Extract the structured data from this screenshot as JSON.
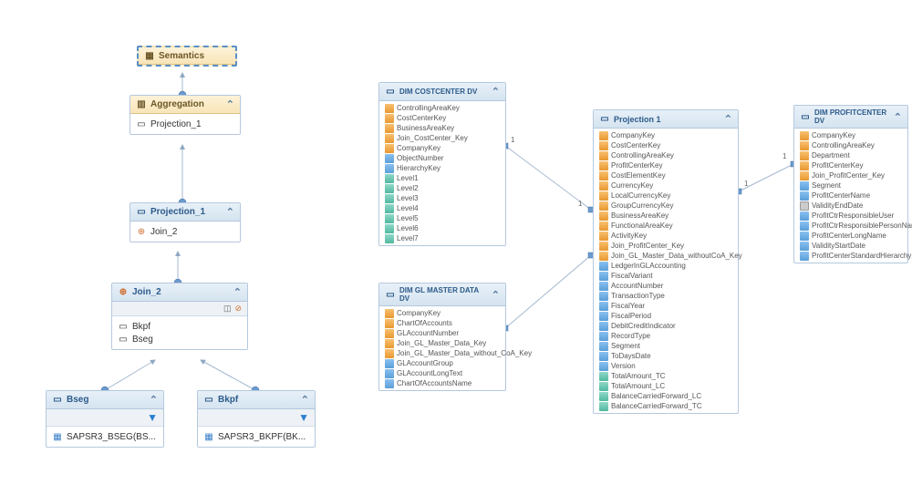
{
  "tree": {
    "semantics": {
      "title": "Semantics"
    },
    "aggregation": {
      "title": "Aggregation",
      "children": [
        "Projection_1"
      ]
    },
    "projection1": {
      "title": "Projection_1",
      "children": [
        "Join_2"
      ]
    },
    "join2": {
      "title": "Join_2",
      "children": [
        "Bkpf",
        "Bseg"
      ]
    },
    "bseg": {
      "title": "Bseg",
      "children": [
        "SAPSR3_BSEG(BS..."
      ]
    },
    "bkpf": {
      "title": "Bkpf",
      "children": [
        "SAPSR3_BKPF(BK..."
      ]
    }
  },
  "entities": {
    "costcenter": {
      "title": "DIM COSTCENTER DV",
      "fields": [
        {
          "icon": "orange",
          "name": "ControllingAreaKey"
        },
        {
          "icon": "orange",
          "name": "CostCenterKey"
        },
        {
          "icon": "orange",
          "name": "BusinessAreaKey"
        },
        {
          "icon": "orange",
          "name": "Join_CostCenter_Key"
        },
        {
          "icon": "orange",
          "name": "CompanyKey"
        },
        {
          "icon": "blue",
          "name": "ObjectNumber"
        },
        {
          "icon": "blue",
          "name": "HierarchyKey"
        },
        {
          "icon": "teal",
          "name": "Level1"
        },
        {
          "icon": "teal",
          "name": "Level2"
        },
        {
          "icon": "teal",
          "name": "Level3"
        },
        {
          "icon": "teal",
          "name": "Level4"
        },
        {
          "icon": "teal",
          "name": "Level5"
        },
        {
          "icon": "teal",
          "name": "Level6"
        },
        {
          "icon": "teal",
          "name": "Level7"
        }
      ]
    },
    "glmaster": {
      "title": "DIM GL MASTER DATA DV",
      "fields": [
        {
          "icon": "orange",
          "name": "CompanyKey"
        },
        {
          "icon": "orange",
          "name": "ChartOfAccounts"
        },
        {
          "icon": "orange",
          "name": "GLAccountNumber"
        },
        {
          "icon": "orange",
          "name": "Join_GL_Master_Data_Key"
        },
        {
          "icon": "orange",
          "name": "Join_GL_Master_Data_without_CoA_Key"
        },
        {
          "icon": "blue",
          "name": "GLAccountGroup"
        },
        {
          "icon": "blue",
          "name": "GLAccountLongText"
        },
        {
          "icon": "blue",
          "name": "ChartOfAccountsName"
        }
      ]
    },
    "projection": {
      "title": "Projection 1",
      "fields": [
        {
          "icon": "orange",
          "name": "CompanyKey"
        },
        {
          "icon": "orange",
          "name": "CostCenterKey"
        },
        {
          "icon": "orange",
          "name": "ControllingAreaKey"
        },
        {
          "icon": "orange",
          "name": "ProfitCenterKey"
        },
        {
          "icon": "orange",
          "name": "CostElementKey"
        },
        {
          "icon": "orange",
          "name": "CurrencyKey"
        },
        {
          "icon": "orange",
          "name": "LocalCurrencyKey"
        },
        {
          "icon": "orange",
          "name": "GroupCurrencyKey"
        },
        {
          "icon": "orange",
          "name": "BusinessAreaKey"
        },
        {
          "icon": "orange",
          "name": "FunctionalAreaKey"
        },
        {
          "icon": "orange",
          "name": "ActivityKey"
        },
        {
          "icon": "orange",
          "name": "Join_ProfitCenter_Key"
        },
        {
          "icon": "orange",
          "name": "Join_GL_Master_Data_withoutCoA_Key"
        },
        {
          "icon": "blue",
          "name": "LedgerInGLAccounting"
        },
        {
          "icon": "blue",
          "name": "FiscalVariant"
        },
        {
          "icon": "blue",
          "name": "AccountNumber"
        },
        {
          "icon": "blue",
          "name": "TransactionType"
        },
        {
          "icon": "blue",
          "name": "FiscalYear"
        },
        {
          "icon": "blue",
          "name": "FiscalPeriod"
        },
        {
          "icon": "blue",
          "name": "DebitCreditIndicator"
        },
        {
          "icon": "blue",
          "name": "RecordType"
        },
        {
          "icon": "blue",
          "name": "Segment"
        },
        {
          "icon": "blue",
          "name": "ToDaysDate"
        },
        {
          "icon": "blue",
          "name": "Version"
        },
        {
          "icon": "teal",
          "name": "TotalAmount_TC"
        },
        {
          "icon": "teal",
          "name": "TotalAmount_LC"
        },
        {
          "icon": "teal",
          "name": "BalanceCarriedForward_LC"
        },
        {
          "icon": "teal",
          "name": "BalanceCarriedForward_TC"
        }
      ]
    },
    "profitcenter": {
      "title": "DIM PROFITCENTER DV",
      "fields": [
        {
          "icon": "orange",
          "name": "CompanyKey"
        },
        {
          "icon": "orange",
          "name": "ControllingAreaKey"
        },
        {
          "icon": "orange",
          "name": "Department"
        },
        {
          "icon": "orange",
          "name": "ProfitCenterKey"
        },
        {
          "icon": "orange",
          "name": "Join_ProfitCenter_Key"
        },
        {
          "icon": "blue",
          "name": "Segment"
        },
        {
          "icon": "blue",
          "name": "ProfitCenterName"
        },
        {
          "icon": "gray",
          "name": "ValidityEndDate"
        },
        {
          "icon": "blue",
          "name": "ProfitCtrResponsibleUser"
        },
        {
          "icon": "blue",
          "name": "ProfitCtrResponsiblePersonName"
        },
        {
          "icon": "blue",
          "name": "ProfitCenterLongName"
        },
        {
          "icon": "blue",
          "name": "ValidityStartDate"
        },
        {
          "icon": "blue",
          "name": "ProfitCenterStandardHierarchy"
        }
      ]
    }
  }
}
